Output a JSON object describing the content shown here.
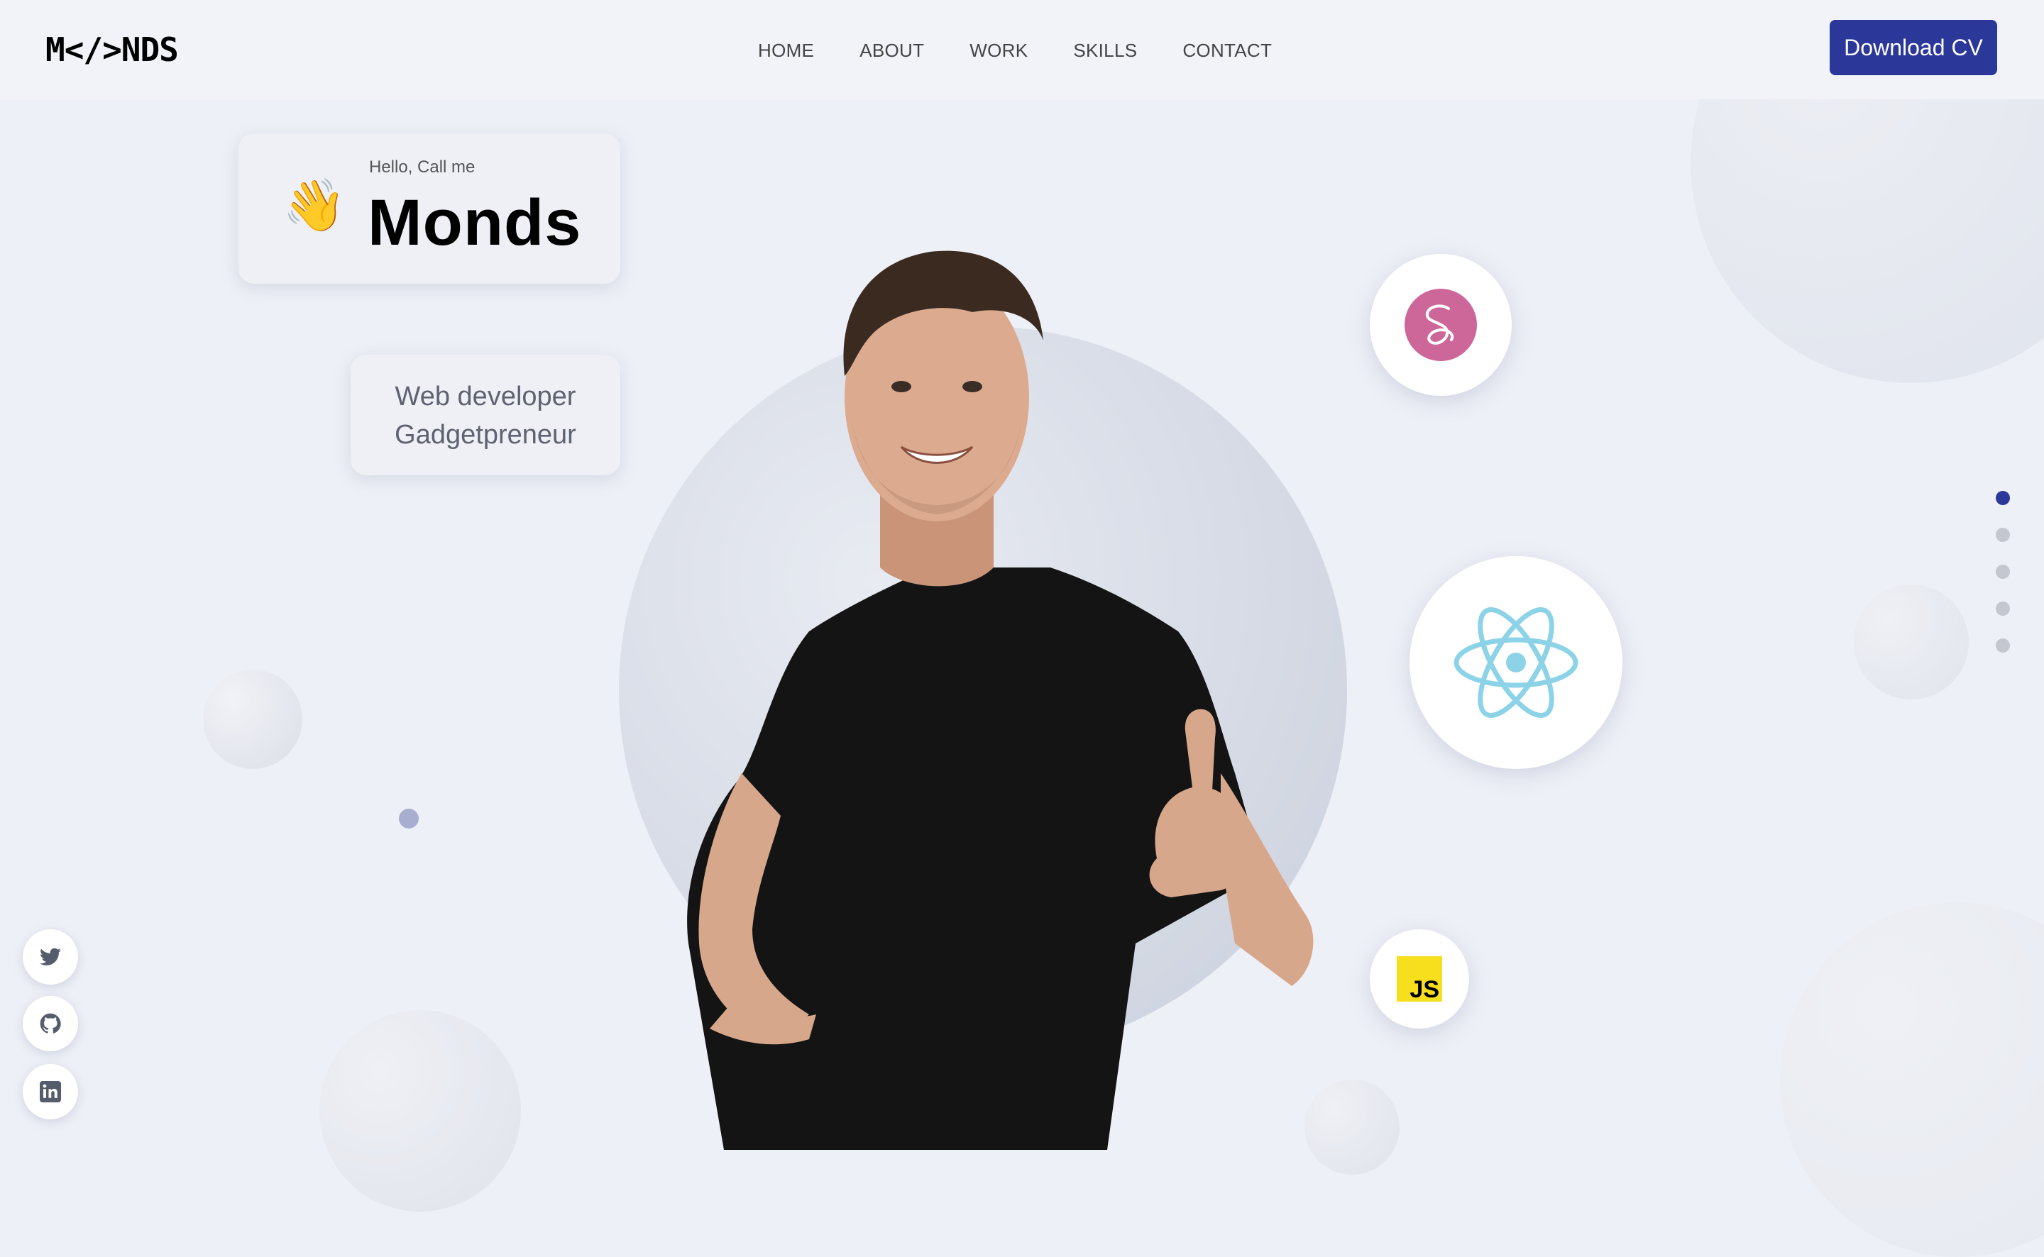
{
  "header": {
    "logo": "M</>NDS",
    "nav": [
      {
        "label": "HOME"
      },
      {
        "label": "ABOUT"
      },
      {
        "label": "WORK"
      },
      {
        "label": "SKILLS"
      },
      {
        "label": "CONTACT"
      }
    ],
    "cta_label": "Download CV"
  },
  "hero": {
    "greeting": "Hello, Call me",
    "wave_emoji": "👋",
    "name": "Monds",
    "roles": [
      "Web developer",
      "Gadgetpreneur"
    ]
  },
  "skills": [
    {
      "icon": "sass-icon",
      "color": "#cd6799"
    },
    {
      "icon": "react-icon",
      "color": "#61dafb"
    },
    {
      "icon": "javascript-icon",
      "color": "#f7df1e",
      "label": "JS"
    }
  ],
  "pagination": {
    "count": 5,
    "active_index": 0
  },
  "social": [
    {
      "icon": "twitter-icon"
    },
    {
      "icon": "github-icon"
    },
    {
      "icon": "linkedin-icon"
    }
  ],
  "colors": {
    "accent": "#2b3799",
    "background": "#eef0f7"
  }
}
